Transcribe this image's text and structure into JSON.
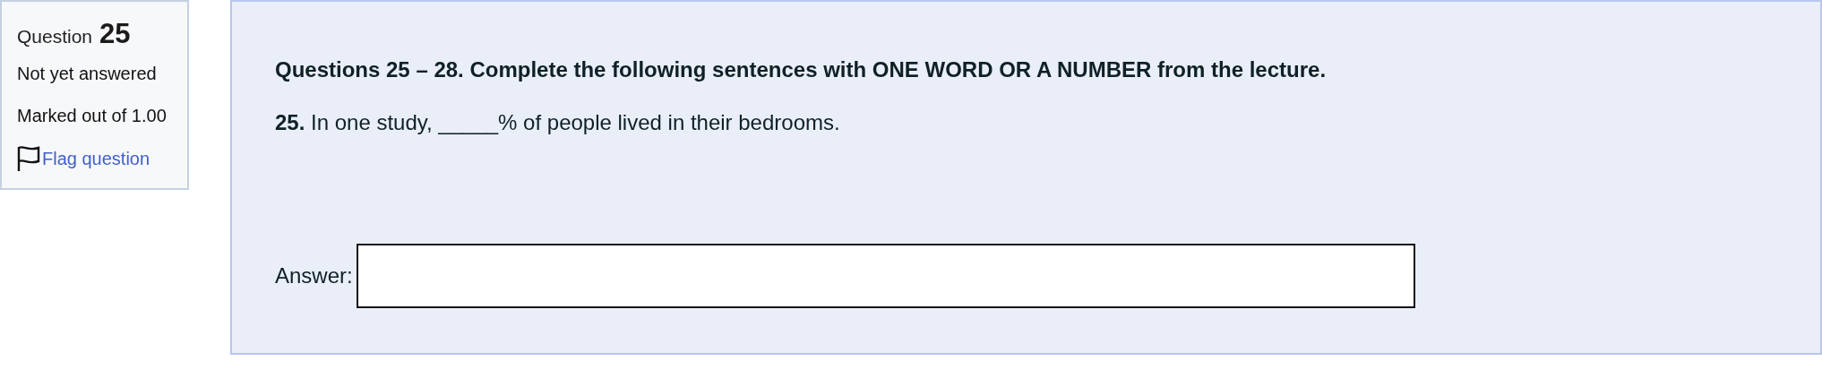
{
  "info": {
    "question_label": "Question",
    "question_number": "25",
    "state": "Not yet answered",
    "grade": "Marked out of 1.00",
    "flag_link": {
      "label": "Flag question",
      "flagged": false
    }
  },
  "content": {
    "instructions": "Questions 25 – 28. Complete the following sentences with ONE WORD OR A NUMBER from the lecture.",
    "question_text": "**25.** In one study, _____% of people lived in their bedrooms.",
    "answer": {
      "label": "Answer:"
    }
  }
}
